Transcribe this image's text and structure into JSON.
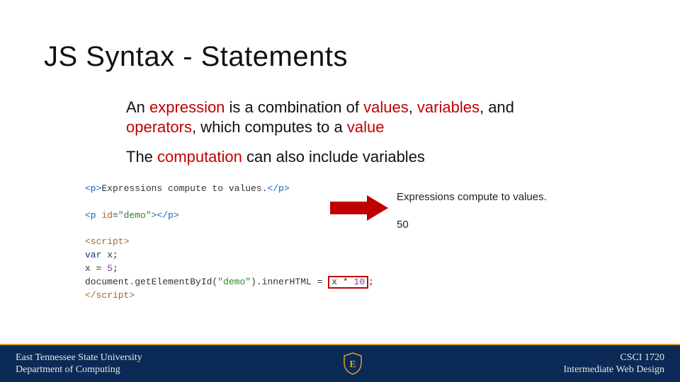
{
  "title": "JS Syntax - Statements",
  "para1": {
    "t1": "An ",
    "k1": "expression",
    "t2": " is a combination of ",
    "k2": "values",
    "t3": ", ",
    "k3": "variables",
    "t4": ", and ",
    "k4": "operators",
    "t5": ", which computes to a ",
    "k5": "value"
  },
  "para2": {
    "t1": "The ",
    "k1": "computation",
    "t2": " can also include variables"
  },
  "code": {
    "l1a": "<p>",
    "l1b": "Expressions compute to values.",
    "l1c": "</p>",
    "l3a": "<p",
    "l3b": " id",
    "l3c": "=",
    "l3d": "\"demo\"",
    "l3e": ">",
    "l3f": "</p>",
    "l5a": "<script>",
    "l6a": "var",
    "l6b": " x;",
    "l7a": "x = ",
    "l7b": "5",
    "l7c": ";",
    "l8a": "document.getElementById(",
    "l8b": "\"demo\"",
    "l8c": ").innerHTML = ",
    "l8box_a": "x * ",
    "l8box_b": "10",
    "l8d": ";",
    "l9a": "</script>"
  },
  "output": {
    "line1": "Expressions compute to values.",
    "line2": "50"
  },
  "footer": {
    "left1": "East Tennessee State University",
    "left2": "Department of Computing",
    "right1": "CSCI 1720",
    "right2": "Intermediate Web Design",
    "logo_letter": "E"
  }
}
